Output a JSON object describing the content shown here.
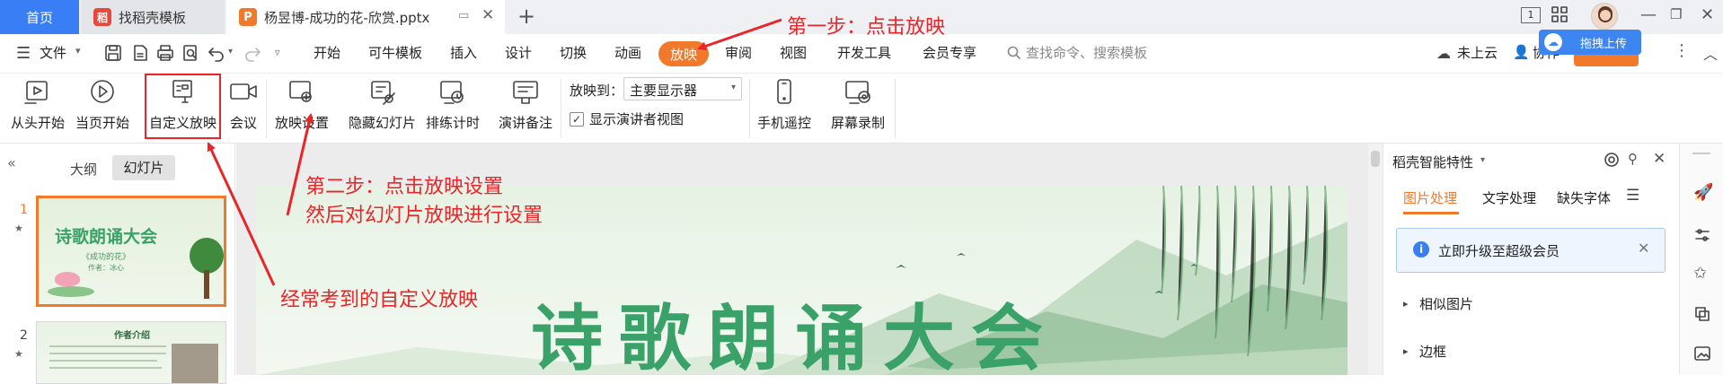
{
  "titlebar": {
    "tab_home": "首页",
    "tab_template": "找稻壳模板",
    "tab_doc": "杨昱博-成功的花-欣赏.pptx",
    "add_tab": "+",
    "page_indicator": "1"
  },
  "menubar": {
    "file": "文件",
    "items": [
      "开始",
      "可牛模板",
      "插入",
      "设计",
      "切换",
      "动画",
      "放映",
      "审阅",
      "视图",
      "开发工具",
      "会员专享"
    ],
    "search_placeholder": "查找命令、搜索模板",
    "cloud": "未上云",
    "collab": "协作",
    "upload_popup": "拖拽上传"
  },
  "ribbon": {
    "from_start": "从头开始",
    "from_current": "当页开始",
    "custom_show": "自定义放映",
    "meeting": "会议",
    "show_settings": "放映设置",
    "hide_slide": "隐藏幻灯片",
    "rehearse": "排练计时",
    "speaker_notes": "演讲备注",
    "show_to_label": "放映到：",
    "show_to_value": "主要显示器",
    "presenter_view": "显示演讲者视图",
    "phone_remote": "手机遥控",
    "screen_record": "屏幕录制"
  },
  "left_panel": {
    "tab_outline": "大纲",
    "tab_slides": "幻灯片",
    "slide1_num": "1",
    "slide2_num": "2",
    "slide1_title": "诗歌朗诵大会",
    "slide1_sub": "《成功的花》",
    "slide1_author": "作者：冰心",
    "slide2_title": "作者介绍"
  },
  "slide": {
    "title": "诗歌朗诵大会"
  },
  "right_panel": {
    "title": "稻壳智能特性",
    "tabs": [
      "图片处理",
      "文字处理",
      "缺失字体"
    ],
    "upgrade": "立即升级至超级会员",
    "similar_images": "相似图片",
    "border": "边框"
  },
  "annotations": {
    "step1": "第一步：点击放映",
    "step2_line1": "第二步：点击放映设置",
    "step2_line2": "然后对幻灯片放映进行设置",
    "custom_note": "经常考到的自定义放映"
  },
  "colors": {
    "accent_orange": "#f0792c",
    "annotation_red": "#e8262a",
    "home_blue": "#3a7ef5",
    "slide_title_green": "#3aa268"
  }
}
